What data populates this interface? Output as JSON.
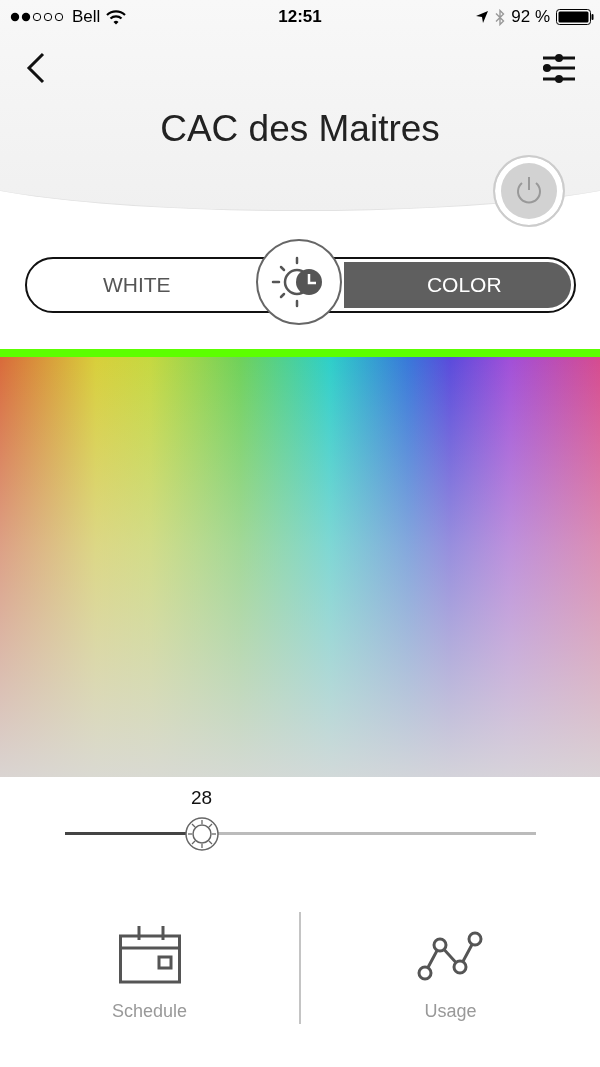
{
  "status_bar": {
    "carrier": "Bell",
    "time": "12:51",
    "battery": "92 %"
  },
  "header": {
    "title": "CAC des Maitres",
    "power": {
      "on": false
    }
  },
  "mode_tabs": [
    {
      "label": "WHITE",
      "selected": false
    },
    {
      "label": "COLOR",
      "selected": true
    }
  ],
  "brightness": {
    "value": "28",
    "level": 0.29
  },
  "nav": [
    {
      "kind": "schedule",
      "label": "Schedule"
    },
    {
      "kind": "usage",
      "label": "Usage"
    }
  ]
}
